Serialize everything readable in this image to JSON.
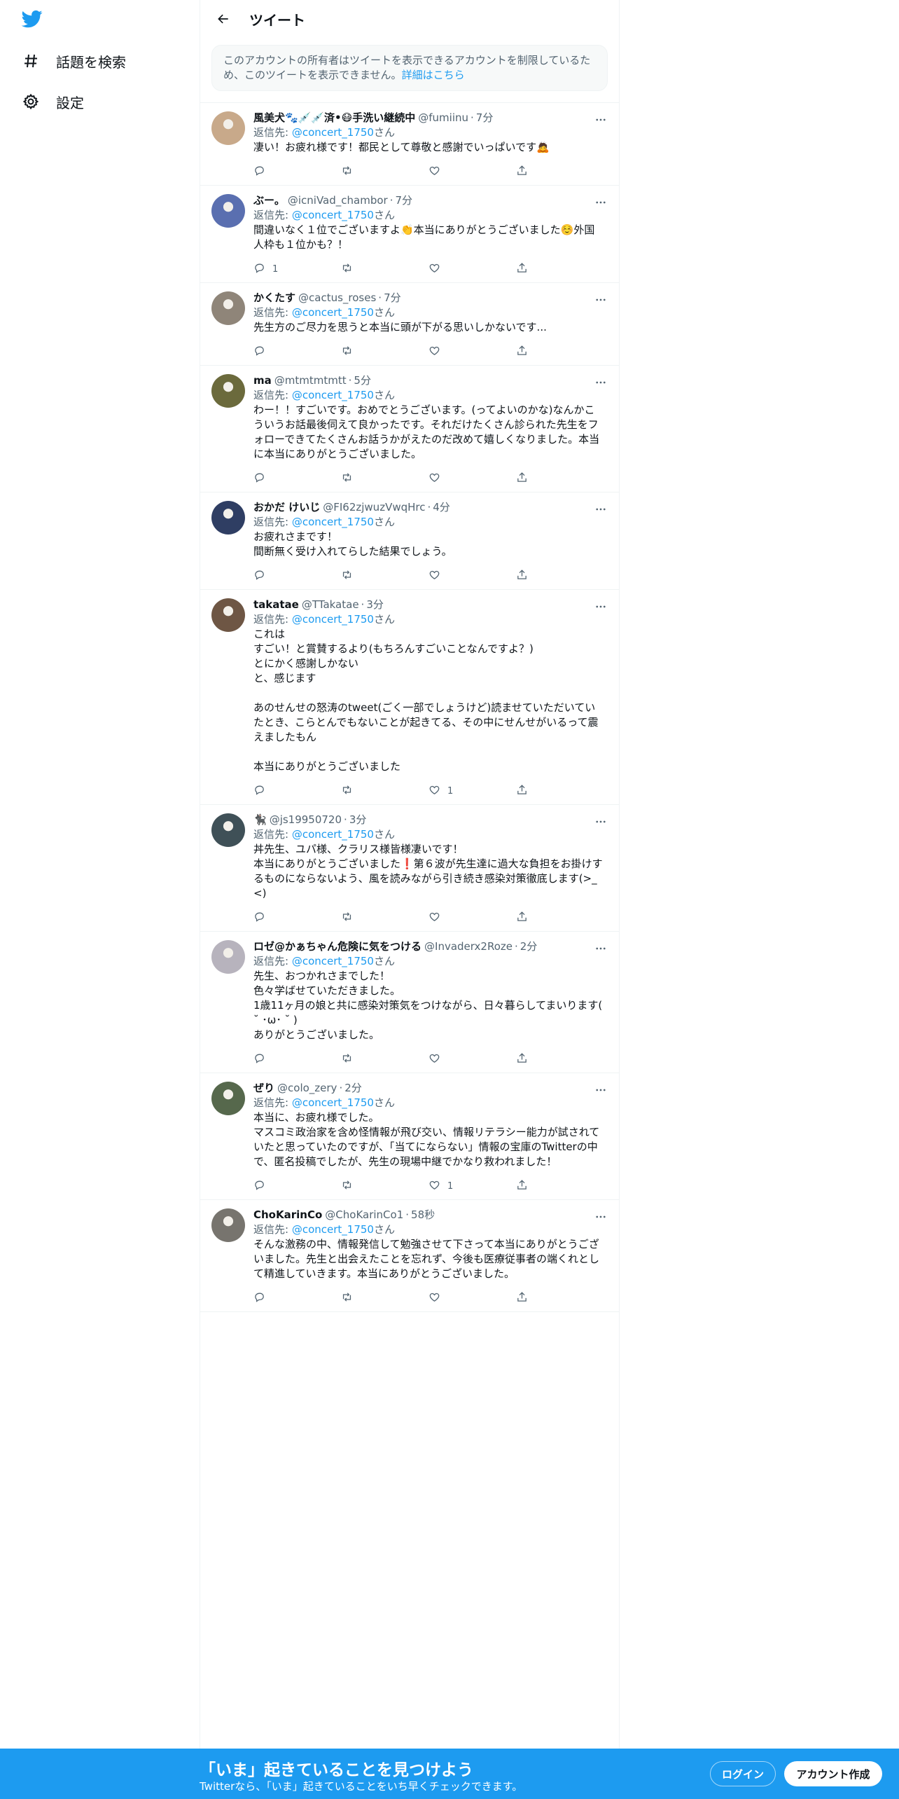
{
  "nav": {
    "explore_label": "話題を検索",
    "settings_label": "設定"
  },
  "header": {
    "title": "ツイート"
  },
  "notice": {
    "text": "このアカウントの所有者はツイートを表示できるアカウントを制限しているため、このツイートを表示できません。",
    "link": "詳細はこちら"
  },
  "reply_prefix": "返信先: ",
  "reply_to": "@concert_1750",
  "reply_suffix": "さん",
  "tweets": [
    {
      "name": "風美犬🐾💉💉済•😷手洗い継続中",
      "handle": "@fumiinu",
      "time": "7分",
      "text": "凄い！お疲れ様です！都民として尊敬と感謝でいっぱいです🙇",
      "reply_count": "",
      "retweet_count": "",
      "like_count": ""
    },
    {
      "name": "ぶー。",
      "handle": "@icniVad_chambor",
      "time": "7分",
      "text": "間違いなく１位でございますよ👏本当にありがとうございました☺️外国人枠も１位かも？！",
      "reply_count": "1",
      "retweet_count": "",
      "like_count": ""
    },
    {
      "name": "かくたす",
      "handle": "@cactus_roses",
      "time": "7分",
      "text": "先生方のご尽力を思うと本当に頭が下がる思いしかないです...",
      "reply_count": "",
      "retweet_count": "",
      "like_count": ""
    },
    {
      "name": "ma",
      "handle": "@mtmtmtmtt",
      "time": "5分",
      "text": "わー！！すごいです。おめでとうございます。(ってよいのかな)なんかこういうお話最後伺えて良かったです。それだけたくさん診られた先生をフォローできてたくさんお話うかがえたのだ改めて嬉しくなりました。本当に本当にありがとうございました。",
      "reply_count": "",
      "retweet_count": "",
      "like_count": ""
    },
    {
      "name": "おかだ けいじ",
      "handle": "@FI62zjwuzVwqHrc",
      "time": "4分",
      "text": "お疲れさまです！\n間断無く受け入れてらした結果でしょう。",
      "reply_count": "",
      "retweet_count": "",
      "like_count": ""
    },
    {
      "name": "takatae",
      "handle": "@TTakatae",
      "time": "3分",
      "text": "これは\nすごい！と賞賛するより(もちろんすごいことなんですよ？)\nとにかく感謝しかない\nと、感じます\n\nあのせんせの怒涛のtweet(ごく一部でしょうけど)読ませていただいていたとき、こらとんでもないことが起きてる、その中にせんせがいるって震えましたもん\n\n本当にありがとうございました",
      "reply_count": "",
      "retweet_count": "",
      "like_count": "1"
    },
    {
      "name": "🐈‍⬛",
      "handle": "@js19950720",
      "time": "3分",
      "text": "丼先生、ユパ様、クラリス様皆様凄いです！\n本当にありがとうございました❗️第６波が先生達に過大な負担をお掛けするものにならないよう、風を読みながら引き続き感染対策徹底します(>_<)",
      "reply_count": "",
      "retweet_count": "",
      "like_count": ""
    },
    {
      "name": "ロゼ@かぁちゃん危険に気をつける",
      "handle": "@Invaderx2Roze",
      "time": "2分",
      "text": "先生、おつかれさまでした！\n色々学ばせていただきました。\n1歳11ヶ月の娘と共に感染対策気をつけながら、日々暮らしてまいります( ˘ ･ω･ ˘ )\nありがとうございました。",
      "reply_count": "",
      "retweet_count": "",
      "like_count": ""
    },
    {
      "name": "ぜり",
      "handle": "@colo_zery",
      "time": "2分",
      "text": "本当に、お疲れ様でした。\nマスコミ政治家を含め怪情報が飛び交い、情報リテラシー能力が試されていたと思っていたのですが、「当てにならない」情報の宝庫のTwitterの中で、匿名投稿でしたが、先生の現場中継でかなり救われました！",
      "reply_count": "",
      "retweet_count": "",
      "like_count": "1"
    },
    {
      "name": "ChoKarinCo",
      "handle": "@ChoKarinCo1",
      "time": "58秒",
      "text": "そんな激務の中、情報発信して勉強させて下さって本当にありがとうございました。先生と出会えたことを忘れず、今後も医療従事者の端くれとして精進していきます。本当にありがとうございました。",
      "reply_count": "",
      "retweet_count": "",
      "like_count": ""
    }
  ],
  "avatars": [
    "#c8a98a",
    "#5a6fb0",
    "#8f8579",
    "#6b6a3c",
    "#2f3e63",
    "#6e5644",
    "#3f5057",
    "#b7b3bd",
    "#56684c",
    "#77746e"
  ],
  "bottom_bar": {
    "title": "「いま」起きていることを見つけよう",
    "subtitle": "Twitterなら、「いま」起きていることをいち早くチェックできます。",
    "login": "ログイン",
    "signup": "アカウント作成"
  },
  "colors": {
    "accent": "#1d9bf0",
    "text": "#0f1419",
    "muted": "#536471"
  }
}
